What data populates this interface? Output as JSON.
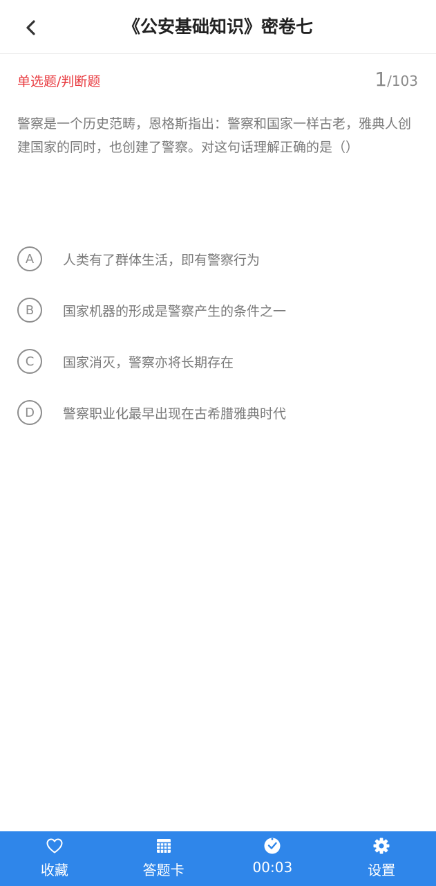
{
  "header": {
    "title": "《公安基础知识》密卷七"
  },
  "question": {
    "type_label": "单选题/判断题",
    "current": "1",
    "separator": "/",
    "total": "103",
    "text": "警察是一个历史范畴，恩格斯指出：警察和国家一样古老，雅典人创建国家的同时，也创建了警察。对这句话理解正确的是（）",
    "options": [
      {
        "letter": "A",
        "text": "人类有了群体生活，即有警察行为"
      },
      {
        "letter": "B",
        "text": "国家机器的形成是警察产生的条件之一"
      },
      {
        "letter": "C",
        "text": "国家消灭，警察亦将长期存在"
      },
      {
        "letter": "D",
        "text": "警察职业化最早出现在古希腊雅典时代"
      }
    ]
  },
  "bottom_bar": {
    "favorite": {
      "label": "收藏",
      "icon": "heart-outline-icon"
    },
    "answer_card": {
      "label": "答题卡",
      "icon": "grid-card-icon"
    },
    "timer": {
      "label": "00:03",
      "icon": "clock-icon"
    },
    "settings": {
      "label": "设置",
      "icon": "gear-icon"
    }
  },
  "colors": {
    "accent_blue": "#2f86ea",
    "type_red": "#e8383d",
    "text_gray": "#7a7a7a"
  }
}
